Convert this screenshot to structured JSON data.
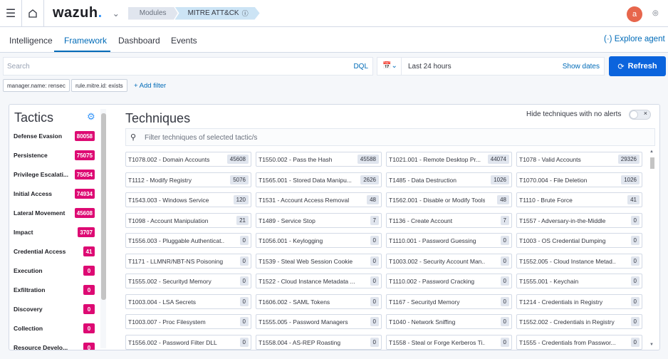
{
  "topbar": {
    "logo": "wazuh",
    "logo_dot": ".",
    "breadcrumb_1": "Modules",
    "breadcrumb_2": "MITRE ATT&CK",
    "avatar_initial": "a",
    "icons": [
      "menu-icon",
      "home-icon",
      "chevron-down-icon",
      "info-icon",
      "help-icon"
    ]
  },
  "tabs": {
    "items": [
      {
        "label": "Intelligence",
        "active": false
      },
      {
        "label": "Framework",
        "active": true
      },
      {
        "label": "Dashboard",
        "active": false
      },
      {
        "label": "Events",
        "active": false
      }
    ],
    "explore_agent": "Explore agent"
  },
  "search": {
    "placeholder": "Search",
    "language": "DQL",
    "time_range": "Last 24 hours",
    "show_dates": "Show dates",
    "refresh": "Refresh"
  },
  "filters": {
    "pills": [
      "manager.name: rensec",
      "rule.mitre.id: exists"
    ],
    "add_filter": "+ Add filter"
  },
  "tactics": {
    "title": "Tactics",
    "items": [
      {
        "name": "Defense Evasion",
        "count": "80058"
      },
      {
        "name": "Persistence",
        "count": "75075"
      },
      {
        "name": "Privilege Escalati...",
        "count": "75054"
      },
      {
        "name": "Initial Access",
        "count": "74934"
      },
      {
        "name": "Lateral Movement",
        "count": "45608"
      },
      {
        "name": "Impact",
        "count": "3707"
      },
      {
        "name": "Credential Access",
        "count": "41"
      },
      {
        "name": "Execution",
        "count": "0"
      },
      {
        "name": "Exfiltration",
        "count": "0"
      },
      {
        "name": "Discovery",
        "count": "0"
      },
      {
        "name": "Collection",
        "count": "0"
      },
      {
        "name": "Resource Develo...",
        "count": "0"
      }
    ]
  },
  "techniques": {
    "title": "Techniques",
    "hide_label": "Hide techniques with no alerts",
    "search_placeholder": "Filter techniques of selected tactic/s",
    "rows": [
      [
        {
          "label": "T1078.002 - Domain Accounts",
          "count": "45608"
        },
        {
          "label": "T1550.002 - Pass the Hash",
          "count": "45588"
        },
        {
          "label": "T1021.001 - Remote Desktop Pr...",
          "count": "44074"
        },
        {
          "label": "T1078 - Valid Accounts",
          "count": "29326"
        }
      ],
      [
        {
          "label": "T1112 - Modify Registry",
          "count": "5076"
        },
        {
          "label": "T1565.001 - Stored Data Manipu...",
          "count": "2626"
        },
        {
          "label": "T1485 - Data Destruction",
          "count": "1026"
        },
        {
          "label": "T1070.004 - File Deletion",
          "count": "1026"
        }
      ],
      [
        {
          "label": "T1543.003 - Windows Service",
          "count": "120"
        },
        {
          "label": "T1531 - Account Access Removal",
          "count": "48"
        },
        {
          "label": "T1562.001 - Disable or Modify Tools",
          "count": "48"
        },
        {
          "label": "T1110 - Brute Force",
          "count": "41"
        }
      ],
      [
        {
          "label": "T1098 - Account Manipulation",
          "count": "21"
        },
        {
          "label": "T1489 - Service Stop",
          "count": "7"
        },
        {
          "label": "T1136 - Create Account",
          "count": "7"
        },
        {
          "label": "T1557 - Adversary-in-the-Middle",
          "count": "0"
        }
      ],
      [
        {
          "label": "T1556.003 - Pluggable Authenticat...",
          "count": "0"
        },
        {
          "label": "T1056.001 - Keylogging",
          "count": "0"
        },
        {
          "label": "T1110.001 - Password Guessing",
          "count": "0"
        },
        {
          "label": "T1003 - OS Credential Dumping",
          "count": "0"
        }
      ],
      [
        {
          "label": "T1171 - LLMNR/NBT-NS Poisoning ...",
          "count": "0"
        },
        {
          "label": "T1539 - Steal Web Session Cookie",
          "count": "0"
        },
        {
          "label": "T1003.002 - Security Account Man...",
          "count": "0"
        },
        {
          "label": "T1552.005 - Cloud Instance Metad...",
          "count": "0"
        }
      ],
      [
        {
          "label": "T1555.002 - Securityd Memory",
          "count": "0"
        },
        {
          "label": "T1522 - Cloud Instance Metadata ...",
          "count": "0"
        },
        {
          "label": "T1110.002 - Password Cracking",
          "count": "0"
        },
        {
          "label": "T1555.001 - Keychain",
          "count": "0"
        }
      ],
      [
        {
          "label": "T1003.004 - LSA Secrets",
          "count": "0"
        },
        {
          "label": "T1606.002 - SAML Tokens",
          "count": "0"
        },
        {
          "label": "T1167 - Securityd Memory",
          "count": "0"
        },
        {
          "label": "T1214 - Credentials in Registry",
          "count": "0"
        }
      ],
      [
        {
          "label": "T1003.007 - Proc Filesystem",
          "count": "0"
        },
        {
          "label": "T1555.005 - Password Managers",
          "count": "0"
        },
        {
          "label": "T1040 - Network Sniffing",
          "count": "0"
        },
        {
          "label": "T1552.002 - Credentials in Registry",
          "count": "0"
        }
      ],
      [
        {
          "label": "T1556.002 - Password Filter DLL",
          "count": "0"
        },
        {
          "label": "T1558.004 - AS-REP Roasting",
          "count": "0"
        },
        {
          "label": "T1558 - Steal or Forge Kerberos Ti...",
          "count": "0"
        },
        {
          "label": "T1555 - Credentials from Passwor...",
          "count": "0"
        }
      ]
    ]
  },
  "colors": {
    "accent": "#006bb8",
    "refresh_bg": "#0b64dd",
    "badge": "#dd0a73",
    "avatar": "#e7664c"
  }
}
